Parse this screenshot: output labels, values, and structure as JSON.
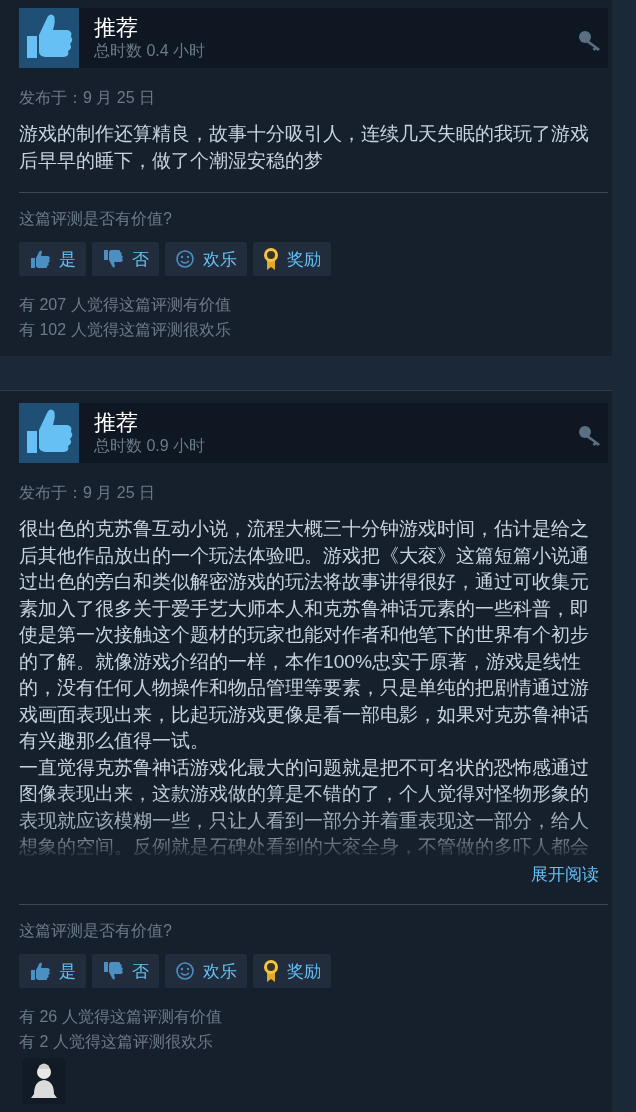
{
  "reviews": [
    {
      "recommendation": "推荐",
      "hours": "总时数 0.4 小时",
      "posted": "发布于：9 月 25 日",
      "paragraphs": [
        "游戏的制作还算精良，故事十分吸引人，连续几天失眠的我玩了游戏后早早的睡下，做了个潮湿安稳的梦"
      ],
      "truncated": false,
      "question": "这篇评测是否有价值?",
      "buttons": [
        {
          "kind": "yes",
          "label": "是"
        },
        {
          "kind": "no",
          "label": "否"
        },
        {
          "kind": "funny",
          "label": "欢乐"
        },
        {
          "kind": "award",
          "label": "奖励"
        }
      ],
      "counts": [
        "有 207 人觉得这篇评测有价值",
        "有 102 人觉得这篇评测很欢乐"
      ]
    },
    {
      "recommendation": "推荐",
      "hours": "总时数 0.9 小时",
      "posted": "发布于：9 月 25 日",
      "paragraphs": [
        "很出色的克苏鲁互动小说，流程大概三十分钟游戏时间，估计是给之后其他作品放出的一个玩法体验吧。游戏把《大衮》这篇短篇小说通过出色的旁白和类似解密游戏的玩法将故事讲得很好，通过可收集元素加入了很多关于爱手艺大师本人和克苏鲁神话元素的一些科普，即使是第一次接触这个题材的玩家也能对作者和他笔下的世界有个初步的了解。就像游戏介绍的一样，本作100%忠实于原著，游戏是线性的，没有任何人物操作和物品管理等要素，只是单纯的把剧情通过游戏画面表现出来，比起玩游戏更像是看一部电影，如果对克苏鲁神话有兴趣那么值得一试。",
        "一直觉得克苏鲁神话游戏化最大的问题就是把不可名状的恐怖感通过图像表现出来，这款游戏做的算是不错的了，个人觉得对怪物形象的表现就应该模糊一些，只让人看到一部分并着重表现这一部分，给人想象的空间。反例就是石碑处看到的大衮全身，不管做的多吓人都会"
      ],
      "truncated": true,
      "expand": "展开阅读",
      "question": "这篇评测是否有价值?",
      "buttons": [
        {
          "kind": "yes",
          "label": "是"
        },
        {
          "kind": "no",
          "label": "否"
        },
        {
          "kind": "funny",
          "label": "欢乐"
        },
        {
          "kind": "award",
          "label": "奖励"
        }
      ],
      "counts": [
        "有 26 人觉得这篇评测有价值",
        "有 2 人觉得这篇评测很欢乐"
      ],
      "award_badge": true
    }
  ]
}
